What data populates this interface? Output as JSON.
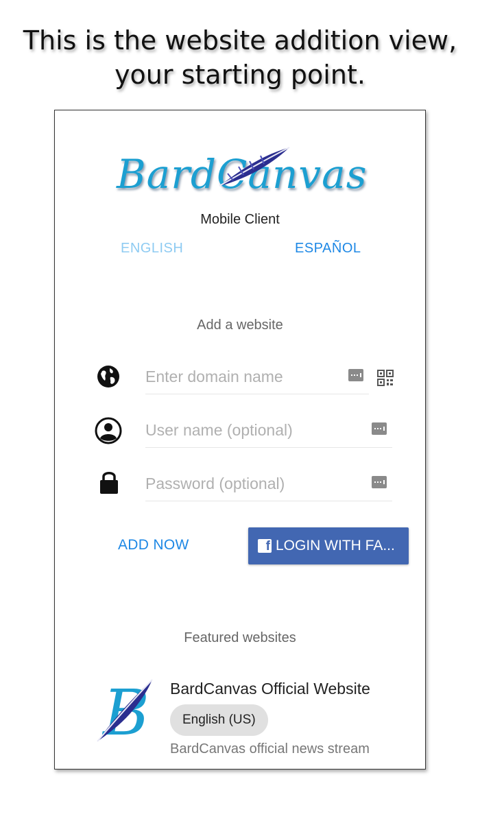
{
  "caption": {
    "line1": "This is the website addition view,",
    "line2": "your starting point."
  },
  "app": {
    "logo_text": "BardCanvas",
    "subtitle": "Mobile Client"
  },
  "languages": {
    "english": "ENGLISH",
    "spanish": "ESPAÑOL"
  },
  "add_website": {
    "title": "Add a website",
    "domain_placeholder": "Enter domain name",
    "username_placeholder": "User name (optional)",
    "password_placeholder": "Password (optional)",
    "add_now_label": "ADD NOW",
    "facebook_label": "LOGIN WITH FA..."
  },
  "featured": {
    "title": "Featured websites",
    "sites": [
      {
        "name": "BardCanvas Official Website",
        "language": "English (US)",
        "description": "BardCanvas official news stream"
      }
    ]
  },
  "colors": {
    "accent": "#1e88e5",
    "facebook": "#4267b2",
    "logo_blue": "#1c9fd1"
  }
}
